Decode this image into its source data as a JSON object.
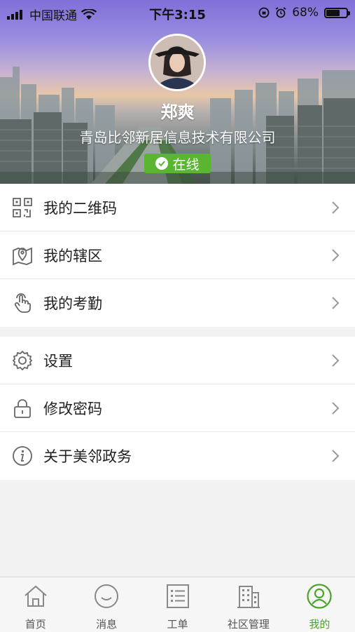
{
  "status_bar": {
    "carrier": "中国联通",
    "time": "下午3:15",
    "battery_percent": "68%",
    "battery_level": 0.68,
    "icons": [
      "signal-icon",
      "wifi-icon",
      "orientation-lock-icon",
      "alarm-icon",
      "battery-icon"
    ]
  },
  "profile": {
    "name": "郑爽",
    "company": "青岛比邻新居信息技术有限公司",
    "status": "在线",
    "status_color": "#5ab531"
  },
  "menu_groups": [
    {
      "items": [
        {
          "label": "我的二维码",
          "icon": "qrcode-icon"
        },
        {
          "label": "我的辖区",
          "icon": "map-pin-icon"
        },
        {
          "label": "我的考勤",
          "icon": "tap-hand-icon"
        }
      ]
    },
    {
      "items": [
        {
          "label": "设置",
          "icon": "gear-icon"
        },
        {
          "label": "修改密码",
          "icon": "lock-icon"
        },
        {
          "label": "关于美邻政务",
          "icon": "info-icon"
        }
      ]
    }
  ],
  "tabbar": {
    "active_index": 4,
    "active_color": "#4aa426",
    "tabs": [
      {
        "label": "首页",
        "icon": "home-icon"
      },
      {
        "label": "消息",
        "icon": "message-icon"
      },
      {
        "label": "工单",
        "icon": "work-order-icon"
      },
      {
        "label": "社区管理",
        "icon": "building-icon"
      },
      {
        "label": "我的",
        "icon": "user-icon"
      }
    ]
  }
}
